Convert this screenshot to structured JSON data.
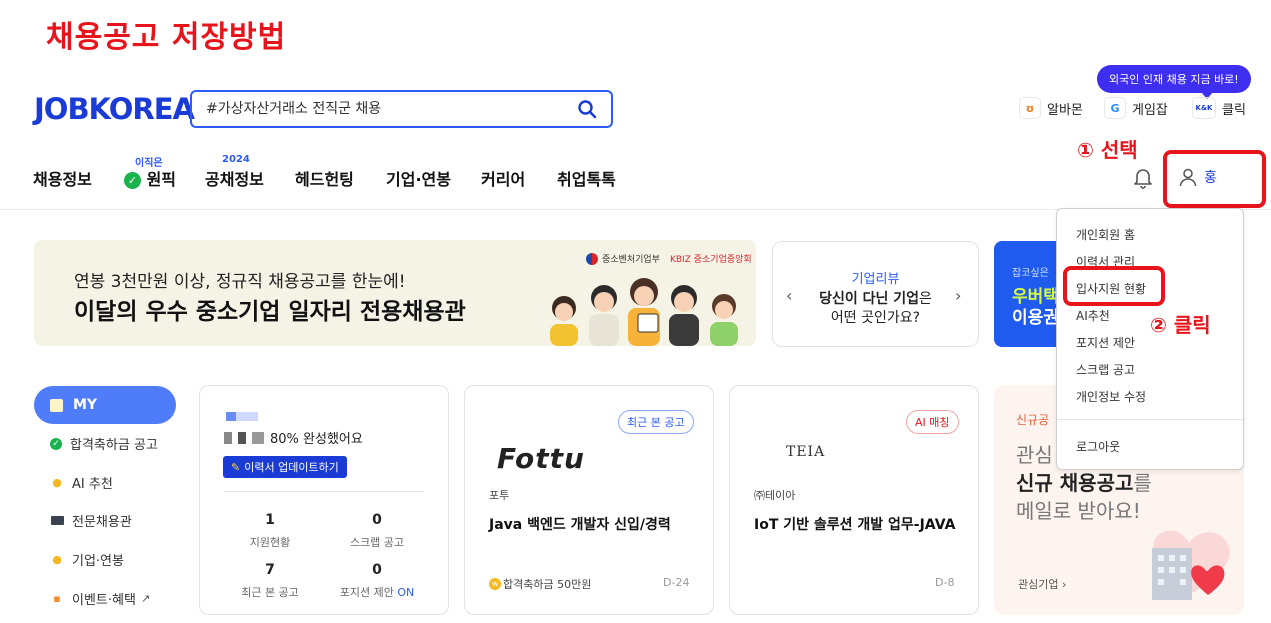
{
  "tutorial": {
    "title": "채용공고 저장방법",
    "step1": "① 선택",
    "step2": "② 클릭"
  },
  "header": {
    "logo": "JOBKOREA",
    "search_placeholder": "#가상자산거래소 전직군 채용",
    "promo_badge": "외국인 인재 채용 지금 바로!",
    "services": [
      {
        "label": "알바몬",
        "icon": "albamon-icon",
        "color": "#f47b20"
      },
      {
        "label": "게임잡",
        "icon": "gamejob-icon",
        "color": "#2d8cf0"
      },
      {
        "label": "클릭",
        "icon": "klik-icon",
        "color": "#1a3bd6"
      }
    ],
    "nav": [
      {
        "label": "채용정보",
        "sup": ""
      },
      {
        "label": "원픽",
        "sup": "이직은"
      },
      {
        "label": "공채정보",
        "sup": "2024"
      },
      {
        "label": "헤드헌팅",
        "sup": ""
      },
      {
        "label": "기업·연봉",
        "sup": ""
      },
      {
        "label": "커리어",
        "sup": ""
      },
      {
        "label": "취업톡톡",
        "sup": ""
      }
    ],
    "user_name": "홍"
  },
  "banner": {
    "sub": "연봉 3천만원 이상, 정규직 채용공고를 한눈에!",
    "main": "이달의 우수 중소기업 일자리 전용채용관",
    "logo1": "중소벤처기업부",
    "logo2": "KBIZ 중소기업중앙회"
  },
  "review_card": {
    "label": "기업리뷰",
    "line1a": "당신이 다닌 기업",
    "line1b": "은",
    "line2": "어떤 곳인가요?"
  },
  "ad_card": {
    "small": "잡코싶은",
    "line1": "우버택",
    "line2": "이용권"
  },
  "dropdown": {
    "items": [
      "개인회원 홈",
      "이력서 관리",
      "입사지원 현황",
      "AI추천",
      "포지션 제안",
      "스크랩 공고",
      "개인정보 수정"
    ],
    "logout": "로그아웃"
  },
  "sidebar": {
    "my": "MY",
    "items": [
      {
        "label": "합격축하금 공고",
        "icon": "check-badge-icon"
      },
      {
        "label": "AI 추천",
        "icon": "bulb-icon"
      },
      {
        "label": "전문채용관",
        "icon": "monitor-icon"
      },
      {
        "label": "기업·연봉",
        "icon": "money-bag-icon"
      },
      {
        "label": "이벤트·혜택",
        "icon": "gift-icon"
      }
    ]
  },
  "profile_card": {
    "completion": "80% 완성했어요",
    "update_button": "이력서 업데이트하기",
    "stats": [
      {
        "value": "1",
        "label": "지원현황"
      },
      {
        "value": "0",
        "label": "스크랩 공고"
      },
      {
        "value": "7",
        "label": "최근 본 공고"
      },
      {
        "value": "0",
        "label": "포지션 제안",
        "extra": "ON"
      }
    ]
  },
  "job_cards": [
    {
      "tag": "최근 본 공고",
      "company_logo": "Fottu",
      "company": "포투",
      "title": "Java 백엔드 개발자 신입/경력",
      "bonus": "합격축하금 50만원",
      "dday": "D-24"
    },
    {
      "tag": "AI 매칭",
      "company_logo": "TEIA",
      "company": "㈜테이아",
      "title": "IoT 기반 솔루션 개발 업무-JAVA",
      "bonus": "",
      "dday": "D-8"
    }
  ],
  "interest_card": {
    "small": "신규공",
    "line1": "관심",
    "line2a": "신규 채용공고",
    "line2b": "를",
    "line3": "메일로 받아요!",
    "link": "관심기업"
  }
}
